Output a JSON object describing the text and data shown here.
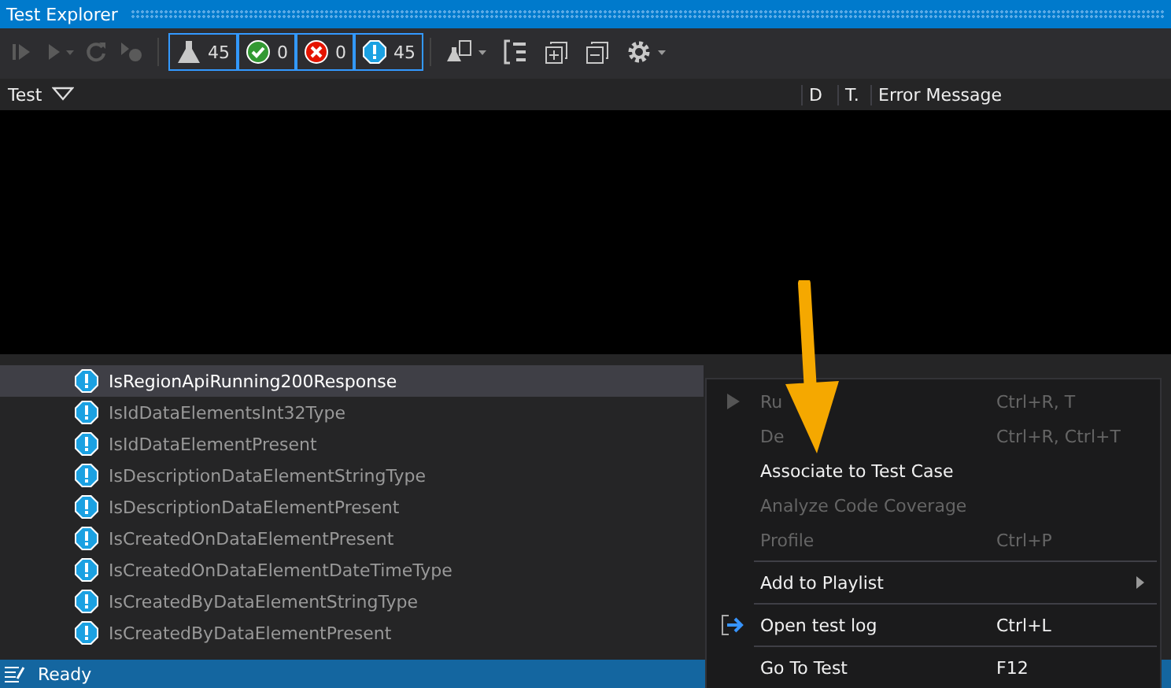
{
  "window": {
    "title": "Test Explorer"
  },
  "toolbar": {
    "buttons": [
      {
        "kind": "run-all",
        "disabled": true
      },
      {
        "kind": "run",
        "disabled": true
      },
      {
        "kind": "refresh",
        "disabled": true
      },
      {
        "kind": "cancel",
        "disabled": true
      }
    ],
    "counters": [
      {
        "kind": "total",
        "count": "45",
        "selected": true
      },
      {
        "kind": "passed",
        "count": "0",
        "selected": true
      },
      {
        "kind": "failed",
        "count": "0",
        "selected": true
      },
      {
        "kind": "not-run",
        "count": "45",
        "selected": true
      }
    ]
  },
  "columns": [
    {
      "label": "Test"
    },
    {
      "label": "D"
    },
    {
      "label": "T."
    },
    {
      "label": "Error Message"
    }
  ],
  "tests": [
    {
      "name": "IsRegionApiRunning200Response",
      "selected": true
    },
    {
      "name": "IsIdDataElementsInt32Type",
      "selected": false
    },
    {
      "name": "IsIdDataElementPresent",
      "selected": false
    },
    {
      "name": "IsDescriptionDataElementStringType",
      "selected": false
    },
    {
      "name": "IsDescriptionDataElementPresent",
      "selected": false
    },
    {
      "name": "IsCreatedOnDataElementPresent",
      "selected": false
    },
    {
      "name": "IsCreatedOnDataElementDateTimeType",
      "selected": false
    },
    {
      "name": "IsCreatedByDataElementStringType",
      "selected": false
    },
    {
      "name": "IsCreatedByDataElementPresent",
      "selected": false
    }
  ],
  "context_menu": [
    {
      "kind": "run",
      "label": "Ru",
      "shortcut": "Ctrl+R, T",
      "disabled": true
    },
    {
      "kind": "item",
      "label": "De",
      "shortcut": "Ctrl+R, Ctrl+T",
      "disabled": true
    },
    {
      "kind": "item",
      "label": "Associate to Test Case",
      "disabled": false
    },
    {
      "kind": "item",
      "label": "Analyze Code Coverage",
      "disabled": true
    },
    {
      "kind": "item",
      "label": "Profile",
      "shortcut": "Ctrl+P",
      "disabled": true
    },
    {
      "kind": "separator"
    },
    {
      "kind": "submenu",
      "label": "Add to Playlist",
      "disabled": false
    },
    {
      "kind": "separator"
    },
    {
      "kind": "log",
      "label": "Open test log",
      "shortcut": "Ctrl+L",
      "disabled": false
    },
    {
      "kind": "separator"
    },
    {
      "kind": "item",
      "label": "Go To Test",
      "shortcut": "F12",
      "disabled": false
    }
  ],
  "status_bar": {
    "text": "Ready"
  }
}
